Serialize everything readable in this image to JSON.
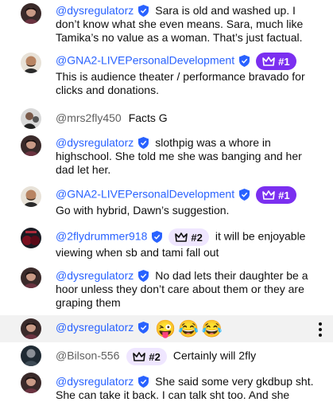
{
  "messages": [
    {
      "author": "@dysregulatorz",
      "verified": true,
      "text": "Sara is old and washed up. I don’t know what she even means. Sara, much like Tamika’s no value as a woman. That’s just factual."
    },
    {
      "author": "@GNA2-LIVEPersonalDevelopment",
      "verified": true,
      "badge": "#1",
      "text": "This is audience theater / performance bravado for clicks and donations."
    },
    {
      "author": "@mrs2fly450",
      "verified": false,
      "text": "Facts G"
    },
    {
      "author": "@dysregulatorz",
      "verified": true,
      "text": "slothpig was a whore in highschool. She told me she was banging and her dad let her."
    },
    {
      "author": "@GNA2-LIVEPersonalDevelopment",
      "verified": true,
      "badge": "#1",
      "text": "Go with hybrid, Dawn’s suggestion."
    },
    {
      "author": "@2flydrummer918",
      "verified": true,
      "badge": "#2",
      "text": "it will be enjoyable viewing when sb and tami fall out"
    },
    {
      "author": "@dysregulatorz",
      "verified": true,
      "text": "No dad lets their daughter be a hoor unless they don’t care about them or they are graping them"
    },
    {
      "author": "@dysregulatorz",
      "verified": true,
      "emojis": [
        "😜",
        "😂",
        "😂"
      ]
    },
    {
      "author": "@Bilson-556",
      "verified": false,
      "badge": "#2",
      "text": "Certainly will 2fly"
    },
    {
      "author": "@dysregulatorz",
      "verified": true,
      "text": "She said some very gkdbup sht. She can take it back. I can talk sht too. And she"
    }
  ],
  "colors": {
    "author": "#2962ff",
    "member_badge_1": "#7b2ff0",
    "member_badge_2": "#efe6ff",
    "hover": "#f2f2f2"
  },
  "icons": {
    "verified": "shield-check-icon",
    "crown": "crown-icon",
    "more": "more-vert-icon"
  }
}
